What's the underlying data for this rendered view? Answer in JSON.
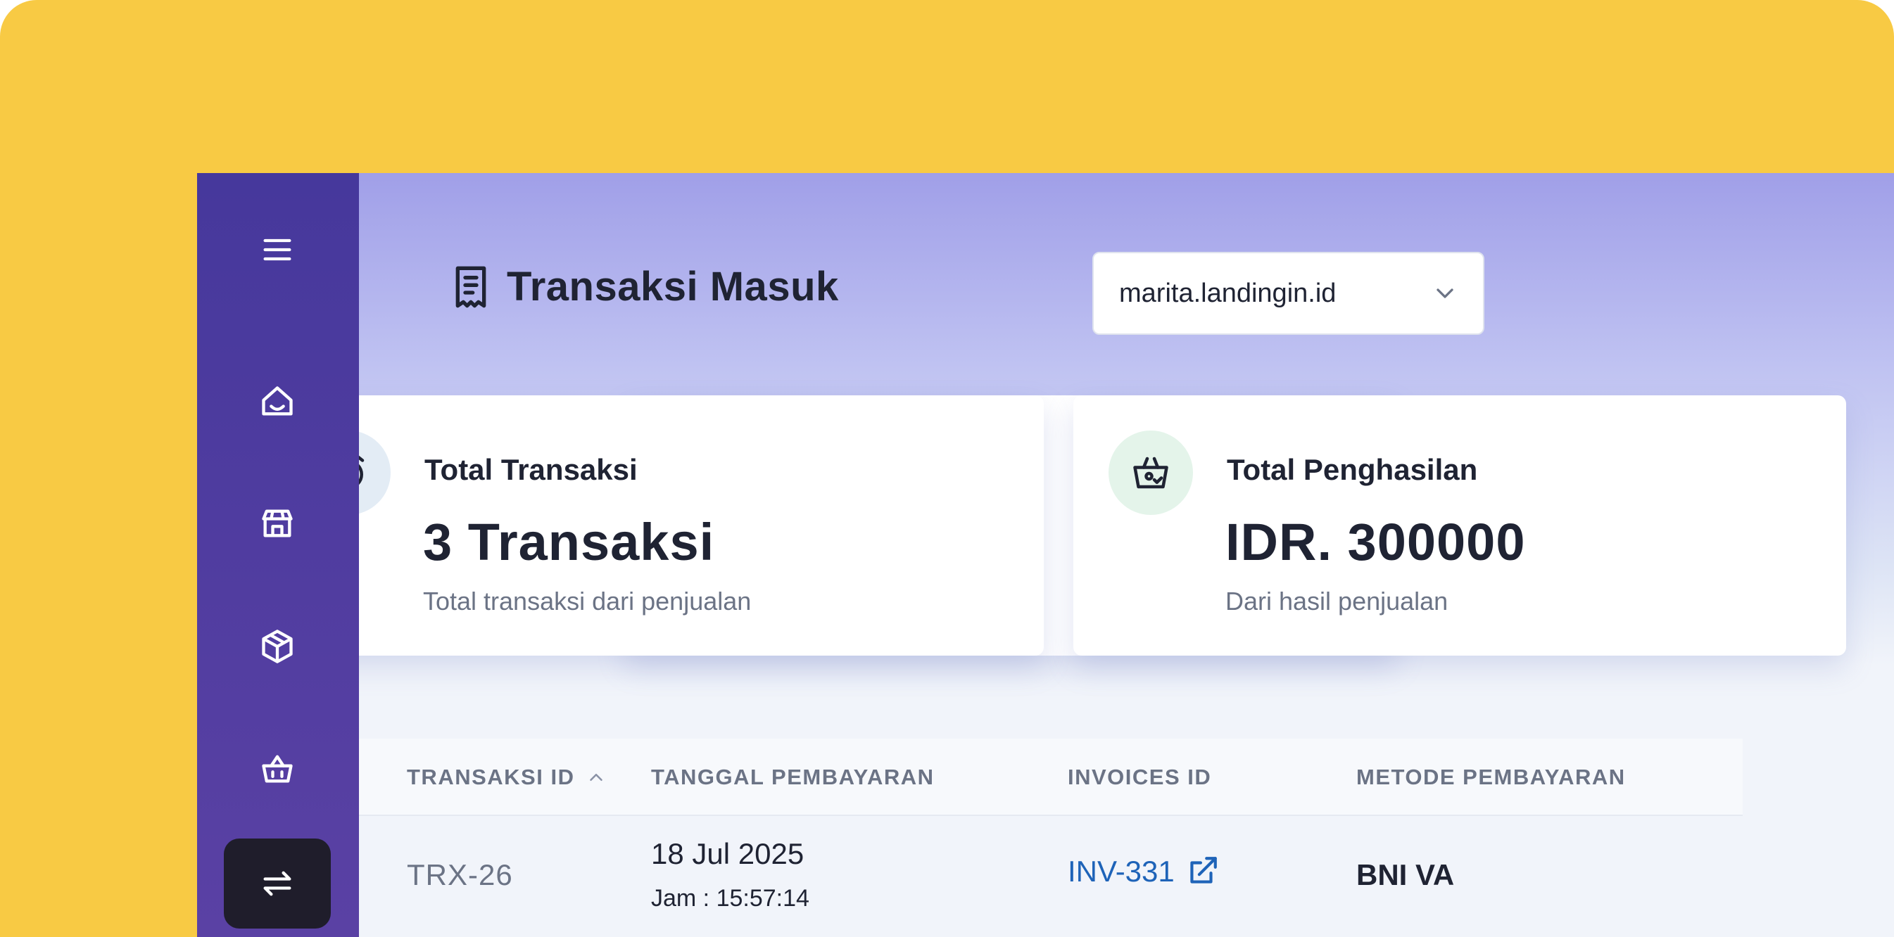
{
  "colors": {
    "background": "#F8CA44",
    "sidebar": "#46389c",
    "active_nav": "#1f1d2b",
    "link": "#1e63b8",
    "heading": "#1f2333",
    "muted": "#6b7385"
  },
  "sidebar": {
    "items": [
      {
        "icon": "menu-icon"
      },
      {
        "icon": "home-icon"
      },
      {
        "icon": "store-icon"
      },
      {
        "icon": "box-icon"
      },
      {
        "icon": "basket-icon"
      },
      {
        "icon": "transfer-icon",
        "active": true
      }
    ]
  },
  "header": {
    "title": "Transaksi Masuk",
    "title_icon": "receipt-icon",
    "site_select": {
      "value": "marita.landingin.id",
      "icon": "chevron-down-icon"
    }
  },
  "stats": [
    {
      "icon": "alarm-clock-icon",
      "icon_bg": "#e3ecf5",
      "label": "Total Transaksi",
      "value": "3 Transaksi",
      "sub": "Total transaksi dari penjualan"
    },
    {
      "icon": "basket-check-icon",
      "icon_bg": "#e4f4ea",
      "label": "Total Penghasilan",
      "value": "IDR. 300000",
      "sub": "Dari hasil penjualan"
    }
  ],
  "table": {
    "headers": {
      "transaksi_id": "TRANSAKSI ID",
      "tanggal": "TANGGAL PEMBAYARAN",
      "invoices": "INVOICES ID",
      "metode": "METODE PEMBAYARAN"
    },
    "sort_icon": "chevron-up-icon",
    "rows": [
      {
        "transaksi_id": "TRX-26",
        "date": "18 Jul 2025",
        "time": "Jam : 15:57:14",
        "invoice_id": "INV-331",
        "invoice_icon": "external-link-icon",
        "method": "BNI VA"
      }
    ]
  }
}
